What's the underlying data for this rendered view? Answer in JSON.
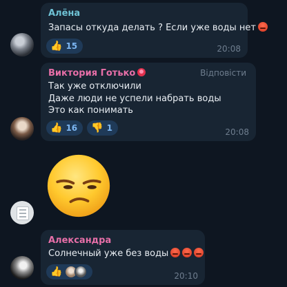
{
  "messages": [
    {
      "author": "Алёна",
      "text_lines": [
        "Запасы откуда делать ? Если уже воды нет"
      ],
      "reactions": [
        {
          "icon": "thumbs-up-icon",
          "count": "15"
        }
      ],
      "time": "20:08"
    },
    {
      "author": "Виктория Готько",
      "reply_label": "Відповісти",
      "text_lines": [
        "Так уже отключили",
        "Даже люди не успели набрать воды",
        "Это как понимать"
      ],
      "reactions": [
        {
          "icon": "thumbs-up-icon",
          "count": "16"
        },
        {
          "icon": "thumbs-down-icon",
          "count": "1"
        }
      ],
      "time": "20:08"
    },
    {
      "author": "Александра",
      "text_lines": [
        "Солнечный уже без воды"
      ],
      "reactions": [
        {
          "icon": "thumbs-up-icon"
        }
      ],
      "time": "20:10"
    }
  ],
  "sticker": {
    "emoji": "unamused-face-emoji"
  },
  "colors": {
    "background": "#0e1621",
    "bubble": "#182533",
    "reaction_pill": "#1f3a58",
    "name_cyan": "#6fc3d6",
    "name_pink": "#e76fa8"
  }
}
